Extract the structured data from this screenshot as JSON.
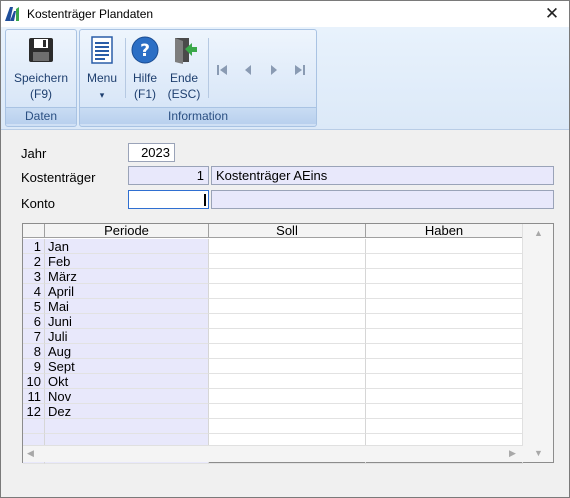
{
  "window": {
    "title": "Kostenträger Plandaten",
    "close_glyph": "✕"
  },
  "ribbon": {
    "groups": [
      {
        "label": "Daten"
      },
      {
        "label": "Information"
      }
    ],
    "save": {
      "label": "Speichern",
      "shortcut": "(F9)",
      "icon": "floppy-disk-icon"
    },
    "menu": {
      "label": "Menu",
      "arrow": "▾",
      "icon": "document-list-icon"
    },
    "help": {
      "label": "Hilfe",
      "shortcut": "(F1)",
      "icon": "help-circle-icon"
    },
    "exit": {
      "label": "Ende",
      "shortcut": "(ESC)",
      "icon": "exit-door-icon"
    },
    "navigation": [
      "first-record-icon",
      "previous-record-icon",
      "next-record-icon",
      "last-record-icon"
    ]
  },
  "form": {
    "year": {
      "label": "Jahr",
      "value": "2023"
    },
    "cost_unit": {
      "label": "Kostenträger",
      "number": "1",
      "name": "Kostenträger AEins"
    },
    "account": {
      "label": "Konto",
      "value": "",
      "name": ""
    }
  },
  "grid": {
    "columns": [
      "Periode",
      "Soll",
      "Haben"
    ],
    "rows": [
      {
        "nr": "1",
        "period": "Jan",
        "soll": "",
        "haben": ""
      },
      {
        "nr": "2",
        "period": "Feb",
        "soll": "",
        "haben": ""
      },
      {
        "nr": "3",
        "period": "März",
        "soll": "",
        "haben": ""
      },
      {
        "nr": "4",
        "period": "April",
        "soll": "",
        "haben": ""
      },
      {
        "nr": "5",
        "period": "Mai",
        "soll": "",
        "haben": ""
      },
      {
        "nr": "6",
        "period": "Juni",
        "soll": "",
        "haben": ""
      },
      {
        "nr": "7",
        "period": "Juli",
        "soll": "",
        "haben": ""
      },
      {
        "nr": "8",
        "period": "Aug",
        "soll": "",
        "haben": ""
      },
      {
        "nr": "9",
        "period": "Sept",
        "soll": "",
        "haben": ""
      },
      {
        "nr": "10",
        "period": "Okt",
        "soll": "",
        "haben": ""
      },
      {
        "nr": "11",
        "period": "Nov",
        "soll": "",
        "haben": ""
      },
      {
        "nr": "12",
        "period": "Dez",
        "soll": "",
        "haben": ""
      },
      {
        "nr": "",
        "period": "",
        "soll": "",
        "haben": ""
      },
      {
        "nr": "",
        "period": "",
        "soll": "",
        "haben": ""
      },
      {
        "nr": "",
        "period": "",
        "soll": "",
        "haben": ""
      }
    ]
  },
  "colors": {
    "ribbon_text": "#1e3f6f",
    "readonly_field": "#e8e8fb",
    "group_label": "#2a4f82"
  }
}
